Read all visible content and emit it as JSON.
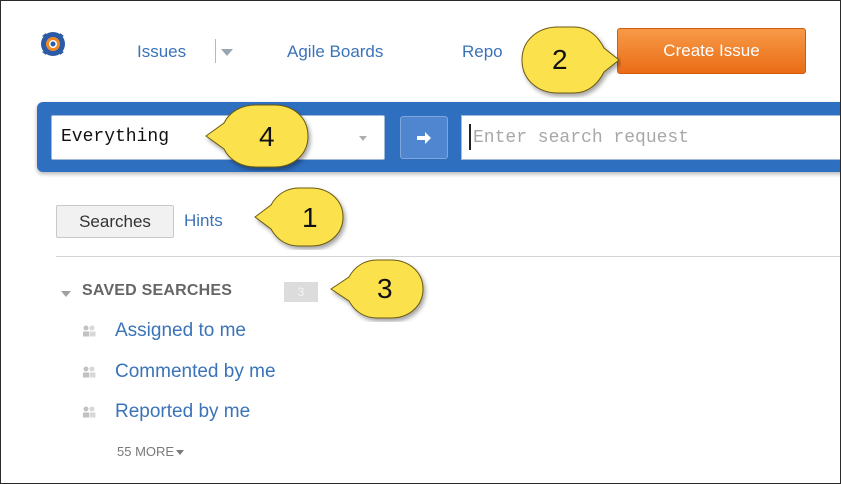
{
  "nav": {
    "issues": "Issues",
    "agile_boards": "Agile Boards",
    "reports": "Repo",
    "create_issue": "Create Issue"
  },
  "search": {
    "context": "Everything",
    "placeholder": "Enter search request"
  },
  "tabs": {
    "searches": "Searches",
    "hints": "Hints"
  },
  "saved_searches": {
    "title": "SAVED SEARCHES",
    "count": "3",
    "items": [
      {
        "label": "Assigned to me"
      },
      {
        "label": "Commented by me"
      },
      {
        "label": "Reported by me"
      }
    ],
    "more": "55 MORE"
  },
  "callouts": {
    "one": "1",
    "two": "2",
    "three": "3",
    "four": "4"
  },
  "colors": {
    "accent_blue": "#2f6fbf",
    "link_blue": "#3b73b9",
    "create_orange": "#ef7c26",
    "callout_yellow": "#fbe14c"
  }
}
